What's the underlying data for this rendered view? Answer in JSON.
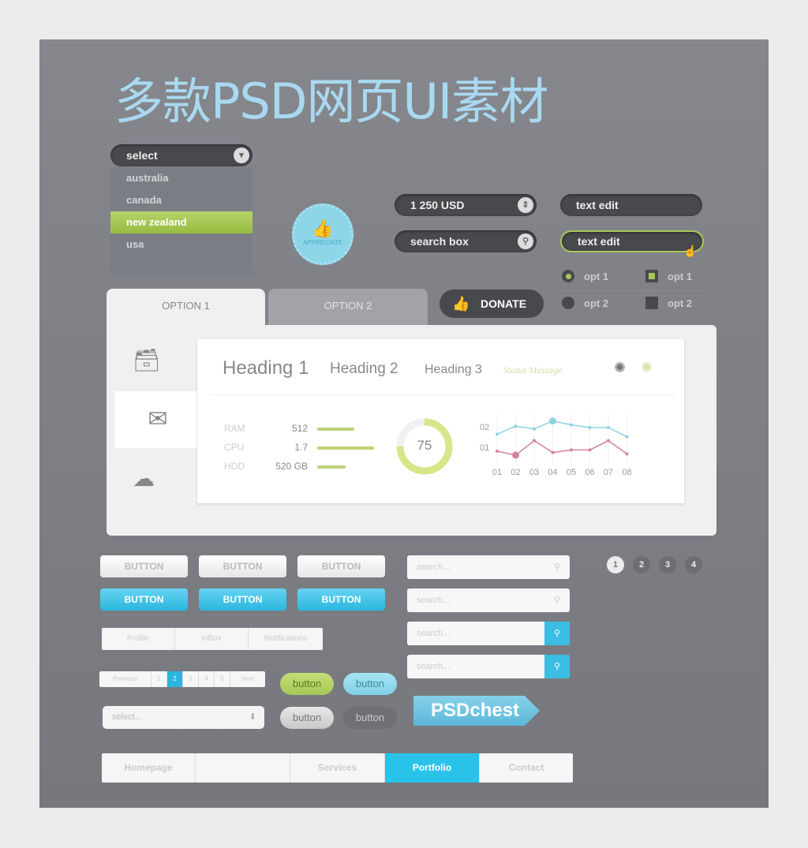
{
  "title": "多款PSD网页UI素材",
  "select": {
    "label": "select",
    "options": [
      "australia",
      "canada",
      "new zealand",
      "usa"
    ],
    "selected": "new zealand"
  },
  "badge": {
    "label": "APPRECIATE"
  },
  "inputs": {
    "currency": "1 250 USD",
    "search": "search box",
    "text1": "text edit",
    "text2": "text edit"
  },
  "radios": [
    {
      "label": "opt 1",
      "checked": true
    },
    {
      "label": "opt 2",
      "checked": false
    }
  ],
  "checkboxes": [
    {
      "label": "opt 1",
      "checked": true
    },
    {
      "label": "opt 2",
      "checked": false
    }
  ],
  "tabs": [
    {
      "label": "OPTION 1",
      "active": true
    },
    {
      "label": "OPTION 2",
      "active": false
    }
  ],
  "donate": "DONATE",
  "headings": {
    "h1": "Heading 1",
    "h2": "Heading 2",
    "h3": "Heading 3",
    "status": "Status Message"
  },
  "stats": [
    {
      "label": "RAM",
      "value": "512",
      "level": 0.65
    },
    {
      "label": "CPU",
      "value": "1.7",
      "level": 1.0
    },
    {
      "label": "HDD",
      "value": "520 GB",
      "level": 0.5
    }
  ],
  "gauge": {
    "value": "75",
    "fraction": 0.75
  },
  "chart_data": {
    "type": "line",
    "categories": [
      "01",
      "02",
      "03",
      "04",
      "05",
      "06",
      "07",
      "08"
    ],
    "yticks": [
      "01",
      "02"
    ],
    "ylim": [
      0.5,
      2.3
    ],
    "series": [
      {
        "color": "#8fd3e0",
        "values": [
          1.6,
          1.9,
          1.8,
          2.1,
          1.95,
          1.85,
          1.85,
          1.5
        ],
        "highlight": 3
      },
      {
        "color": "#d5829b",
        "values": [
          0.95,
          0.8,
          1.35,
          0.9,
          1.0,
          1.0,
          1.35,
          0.85
        ],
        "highlight": 1
      }
    ]
  },
  "buttons": {
    "white": [
      "BUTTON",
      "BUTTON",
      "BUTTON"
    ],
    "blue": [
      "BUTTON",
      "BUTTON",
      "BUTTON"
    ]
  },
  "searches": [
    "search...",
    "search...",
    "search...",
    "search..."
  ],
  "pages": [
    "1",
    "2",
    "3",
    "4"
  ],
  "segments": [
    "Profile",
    "InBox",
    "Notifications"
  ],
  "pagination": [
    "Previous",
    "1",
    "2",
    "3",
    "4",
    "5",
    "Next"
  ],
  "pills": [
    "button",
    "button",
    "button",
    "button"
  ],
  "select2": "select...",
  "logo": "PSDchest",
  "nav": [
    "Homepage",
    "",
    "Services",
    "Portfolio",
    "Contact"
  ],
  "colors": {
    "accent": "#29b7df",
    "green": "#a6c956"
  }
}
